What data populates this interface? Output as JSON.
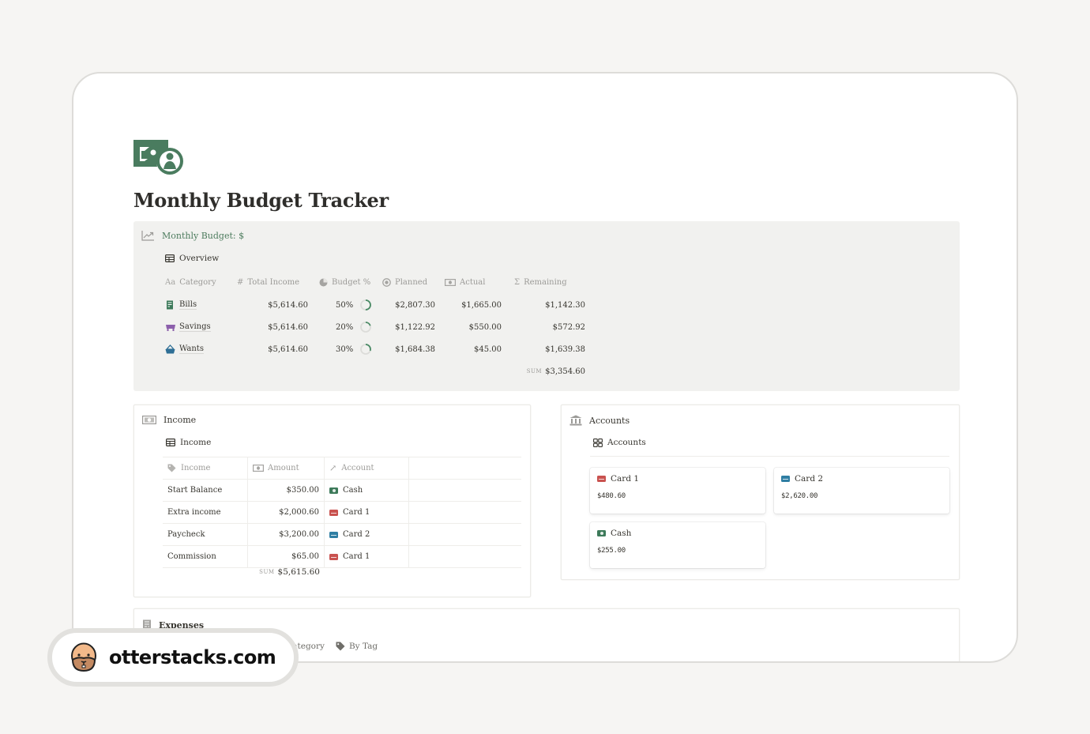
{
  "page": {
    "title": "Monthly Budget Tracker",
    "icon": "money-bill-icon",
    "accent_color": "#4a7c5f"
  },
  "monthly_budget": {
    "callout_label": "Monthly Budget: $",
    "callout_icon": "trend-chart-icon",
    "view_label": "Overview",
    "columns": [
      {
        "label": "Category",
        "icon": "Aa"
      },
      {
        "label": "Total Income",
        "icon": "#"
      },
      {
        "label": "Budget %",
        "icon": "pie-icon"
      },
      {
        "label": "Planned",
        "icon": "target-icon"
      },
      {
        "label": "Actual",
        "icon": "money-icon"
      },
      {
        "label": "Remaining",
        "icon": "Σ"
      }
    ],
    "rows": [
      {
        "category": "Bills",
        "icon": "receipt-icon",
        "icon_color": "#3d7a5a",
        "total_income": "$5,614.60",
        "budget_pct": "50%",
        "progress": 0.5,
        "planned": "$2,807.30",
        "actual": "$1,665.00",
        "remaining": "$1,142.30"
      },
      {
        "category": "Savings",
        "icon": "piggy-bank-icon",
        "icon_color": "#8c5fab",
        "total_income": "$5,614.60",
        "budget_pct": "20%",
        "progress": 0.2,
        "planned": "$1,122.92",
        "actual": "$550.00",
        "remaining": "$572.92"
      },
      {
        "category": "Wants",
        "icon": "basket-icon",
        "icon_color": "#2f6f96",
        "total_income": "$5,614.60",
        "budget_pct": "30%",
        "progress": 0.3,
        "planned": "$1,684.38",
        "actual": "$45.00",
        "remaining": "$1,639.38"
      }
    ],
    "sum_label": "SUM",
    "sum_value": "$3,354.60"
  },
  "income": {
    "title": "Income",
    "view_label": "Income",
    "columns": [
      "Income",
      "Amount",
      "Account"
    ],
    "rows": [
      {
        "name": "Start Balance",
        "amount": "$350.00",
        "account": "Cash",
        "account_type": "cash"
      },
      {
        "name": "Extra income",
        "amount": "$2,000.60",
        "account": "Card 1",
        "account_type": "card1"
      },
      {
        "name": "Paycheck",
        "amount": "$3,200.00",
        "account": "Card 2",
        "account_type": "card2"
      },
      {
        "name": "Commission",
        "amount": "$65.00",
        "account": "Card 1",
        "account_type": "card1"
      }
    ],
    "sum_label": "SUM",
    "sum_value": "$5,615.60"
  },
  "accounts": {
    "title": "Accounts",
    "view_label": "Accounts",
    "cards": [
      {
        "name": "Card 1",
        "balance": "$480.60",
        "type": "card1"
      },
      {
        "name": "Card 2",
        "balance": "$2,620.00",
        "type": "card2"
      },
      {
        "name": "Cash",
        "balance": "$255.00",
        "type": "cash"
      }
    ]
  },
  "account_colors": {
    "card1": "#c9524f",
    "card2": "#2f7ea3",
    "cash": "#3d7a5a"
  },
  "expenses": {
    "title": "Expenses",
    "tabs": [
      {
        "label": "By Category",
        "icon": "list-icon"
      },
      {
        "label": "By Tag",
        "icon": "tag-icon"
      }
    ],
    "partial_tab_fragment": "t"
  },
  "watermark": {
    "text": "otterstacks.com"
  }
}
